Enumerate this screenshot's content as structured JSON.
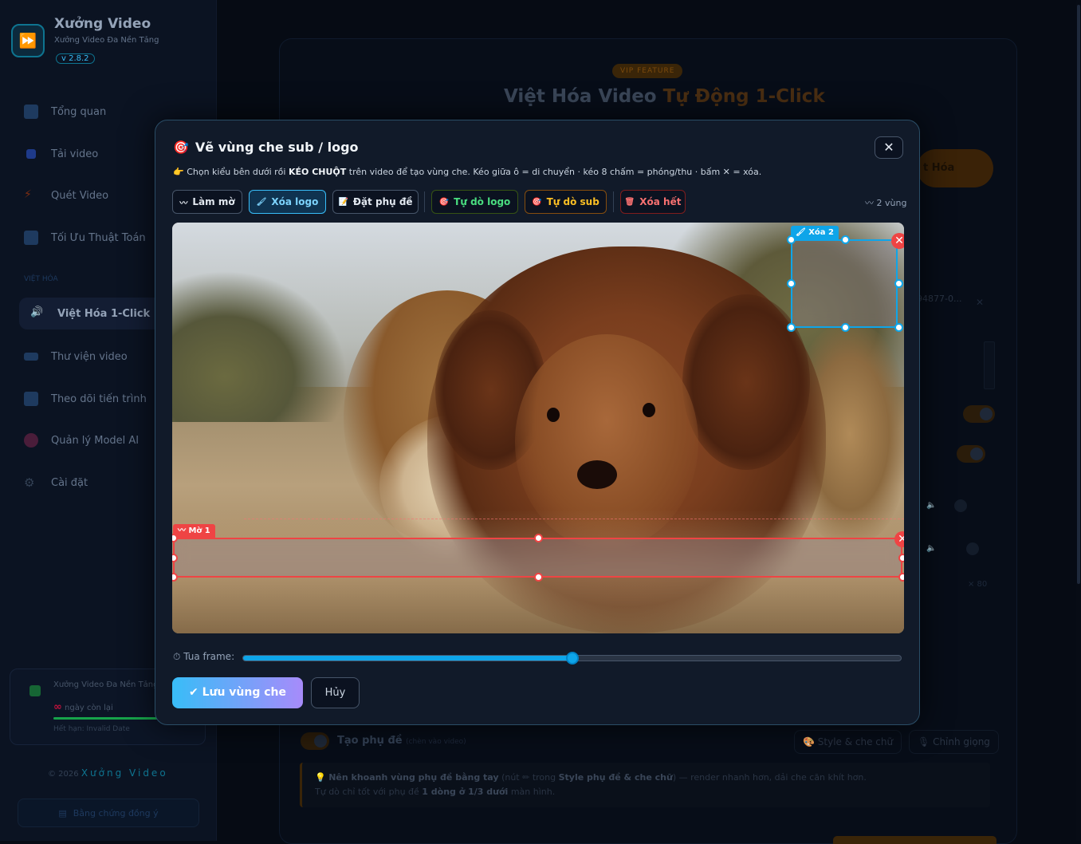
{
  "sidebar": {
    "app_title": "Xưởng Video",
    "app_subtitle": "Xưởng Video Đa Nền Tảng",
    "version": "v 2.8.2",
    "section_label": "VIỆT HÓA",
    "items": [
      {
        "label": "Tổng quan",
        "icon": "chart-icon"
      },
      {
        "label": "Tải video",
        "icon": "download-icon"
      },
      {
        "label": "Quét Video",
        "icon": "lightning-icon"
      },
      {
        "label": "Tối Ưu Thuật Toán",
        "icon": "optimize-icon"
      },
      {
        "label": "Việt Hóa 1-Click",
        "icon": "speaker-icon"
      },
      {
        "label": "Thư viện video",
        "icon": "film-icon"
      },
      {
        "label": "Theo dõi tiến trình",
        "icon": "progress-icon"
      },
      {
        "label": "Quản lý Model AI",
        "icon": "brain-icon"
      },
      {
        "label": "Cài đặt",
        "icon": "gear-icon"
      }
    ],
    "license": {
      "name": "Xưởng Video Đa Nền Tảng",
      "days_value": "∞",
      "days_label": "ngày còn lại",
      "expiry": "Hết hạn: Invalid Date"
    },
    "copyright_year": "© 2026",
    "copyright_brand": "Xưởng Video",
    "proof_button": "Bằng chứng đồng ý"
  },
  "background": {
    "badge": "VIP FEATURE",
    "title_main": "Việt Hóa Video",
    "title_accent": "Tự Động 1-Click",
    "action_button": "t Hóa",
    "file_name": "94877-0...",
    "file_close": "✕",
    "speed_label": "× 80",
    "subtitle_toggle_label": "Tạo phụ đề",
    "subtitle_toggle_note": "(chèn vào video)",
    "style_button": "Style & che chữ",
    "voice_button": "Chỉnh giọng",
    "tip_line1_prefix": "Nên khoanh vùng phụ đề bằng tay",
    "tip_line1_mid": "(nút ✏ trong",
    "tip_line1_bold": "Style phụ đề & che chữ",
    "tip_line1_suffix": ") — render nhanh hơn, dải che căn khít hơn.",
    "tip_line2_prefix": "Tự dò chỉ tốt với phụ đề",
    "tip_line2_bold": "1 dòng ở 1/3 dưới",
    "tip_line2_suffix": "màn hình."
  },
  "modal": {
    "title": "Vẽ vùng che sub / logo",
    "close": "✕",
    "hint_prefix": "👉 Chọn kiểu bên dưới rồi",
    "hint_bold": "KÉO CHUỘT",
    "hint_suffix": "trên video để tạo vùng che. Kéo giữa ô = di chuyển · kéo 8 chấm = phóng/thu · bấm ✕ = xóa.",
    "tools": [
      {
        "label": "Làm mờ",
        "icon": "blur-icon"
      },
      {
        "label": "Xóa logo",
        "icon": "brush-icon"
      },
      {
        "label": "Đặt phụ đề",
        "icon": "memo-icon"
      },
      {
        "label": "Tự dò logo",
        "icon": "target-icon"
      },
      {
        "label": "Tự dò sub",
        "icon": "target-icon"
      },
      {
        "label": "Xóa hết",
        "icon": "trash-icon"
      }
    ],
    "region_count": "2 vùng",
    "regions": [
      {
        "label": "Xóa 2",
        "type": "logo-remove"
      },
      {
        "label": "Mờ 1",
        "type": "blur"
      }
    ],
    "seek_label": "Tua frame:",
    "seek_value": 0.5,
    "save_button": "✔ Lưu vùng che",
    "cancel_button": "Hủy"
  }
}
